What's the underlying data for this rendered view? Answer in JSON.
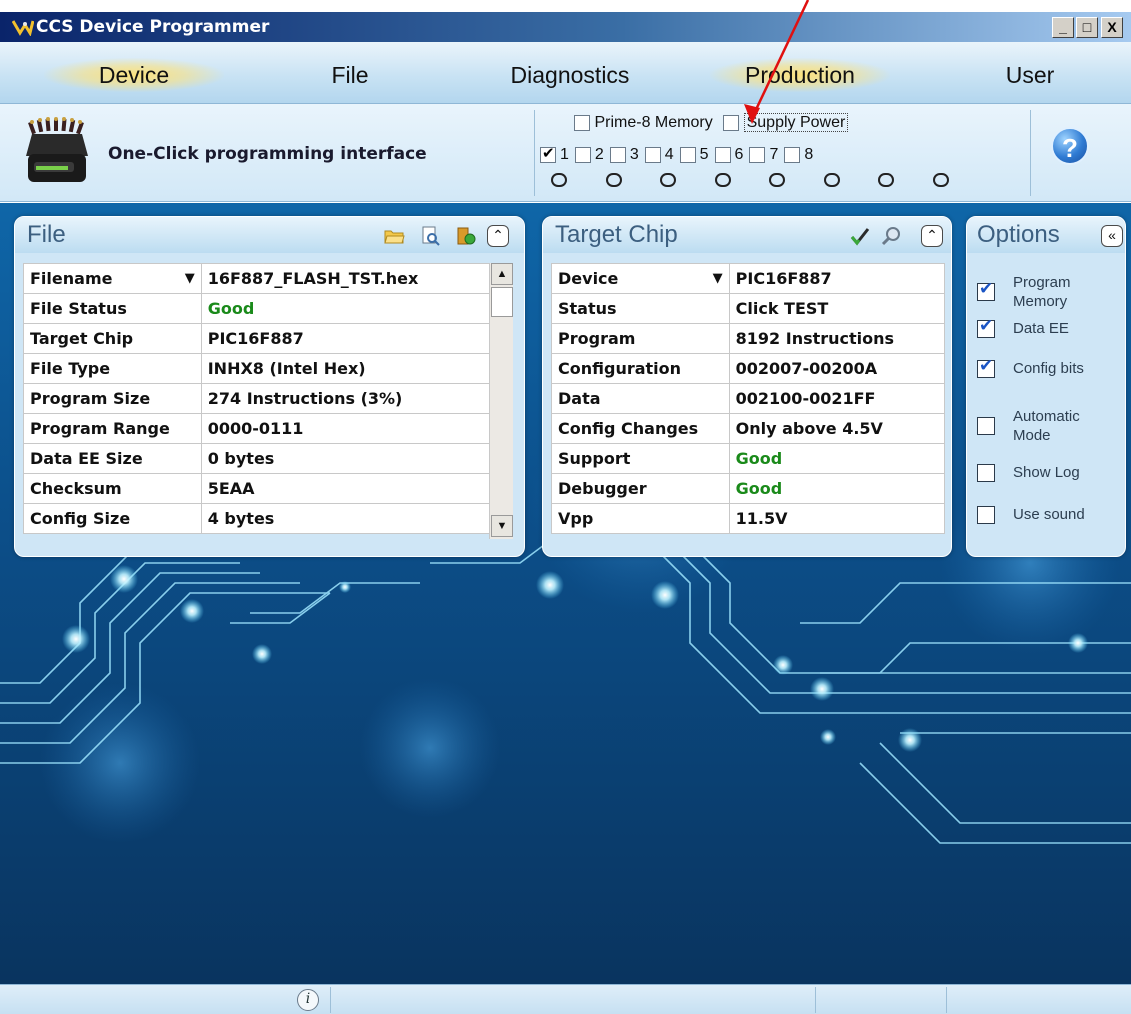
{
  "window": {
    "title": "CCS Device Programmer",
    "controls": [
      "_",
      "□",
      "X"
    ]
  },
  "menu": [
    "Device",
    "File",
    "Diagnostics",
    "Production",
    "User"
  ],
  "toolbar": {
    "label": "One-Click programming interface",
    "prime8_label": "Prime-8 Memory",
    "prime8_checked": false,
    "supply_power_label": "Supply Power",
    "supply_power_checked": false,
    "sockets": [
      {
        "label": "1",
        "checked": true
      },
      {
        "label": "2",
        "checked": false
      },
      {
        "label": "3",
        "checked": false
      },
      {
        "label": "4",
        "checked": false
      },
      {
        "label": "5",
        "checked": false
      },
      {
        "label": "6",
        "checked": false
      },
      {
        "label": "7",
        "checked": false
      },
      {
        "label": "8",
        "checked": false
      }
    ],
    "help_label": "?"
  },
  "file_panel": {
    "title": "File",
    "collapse_glyph": "≪",
    "rows": [
      {
        "key": "Filename",
        "value": "16F887_FLASH_TST.hex",
        "dropdown": true
      },
      {
        "key": "File Status",
        "value": "Good",
        "status": "good"
      },
      {
        "key": "Target Chip",
        "value": "PIC16F887"
      },
      {
        "key": "File Type",
        "value": "INHX8 (Intel Hex)"
      },
      {
        "key": "Program Size",
        "value": "274 Instructions (3%)"
      },
      {
        "key": "Program Range",
        "value": "0000-0111"
      },
      {
        "key": "Data EE Size",
        "value": "0 bytes"
      },
      {
        "key": "Checksum",
        "value": "5EAA"
      },
      {
        "key": "Config Size",
        "value": "4 bytes"
      }
    ]
  },
  "chip_panel": {
    "title": "Target Chip",
    "rows": [
      {
        "key": "Device",
        "value": "PIC16F887",
        "dropdown": true
      },
      {
        "key": "Status",
        "value": "Click TEST"
      },
      {
        "key": "Program",
        "value": "8192 Instructions"
      },
      {
        "key": "Configuration",
        "value": "002007-00200A"
      },
      {
        "key": "Data",
        "value": "002100-0021FF"
      },
      {
        "key": "Config Changes",
        "value": "Only above 4.5V"
      },
      {
        "key": "Support",
        "value": "Good",
        "status": "good"
      },
      {
        "key": "Debugger",
        "value": "Good",
        "status": "good"
      },
      {
        "key": "Vpp",
        "value": "11.5V"
      }
    ]
  },
  "options_panel": {
    "title": "Options",
    "collapse_glyph": "«",
    "items": [
      {
        "label": "Program Memory",
        "checked": true
      },
      {
        "label": "Data EE",
        "checked": true
      },
      {
        "label": "Config bits",
        "checked": true
      },
      {
        "label": "Automatic Mode",
        "checked": false
      },
      {
        "label": "Show Log",
        "checked": false
      },
      {
        "label": "Use sound",
        "checked": false
      }
    ]
  },
  "status_bar": {
    "info_glyph": "i"
  },
  "colors": {
    "good": "#1a8a1a",
    "titlebar": "#0a246a",
    "annotation_arrow": "#e01010"
  }
}
